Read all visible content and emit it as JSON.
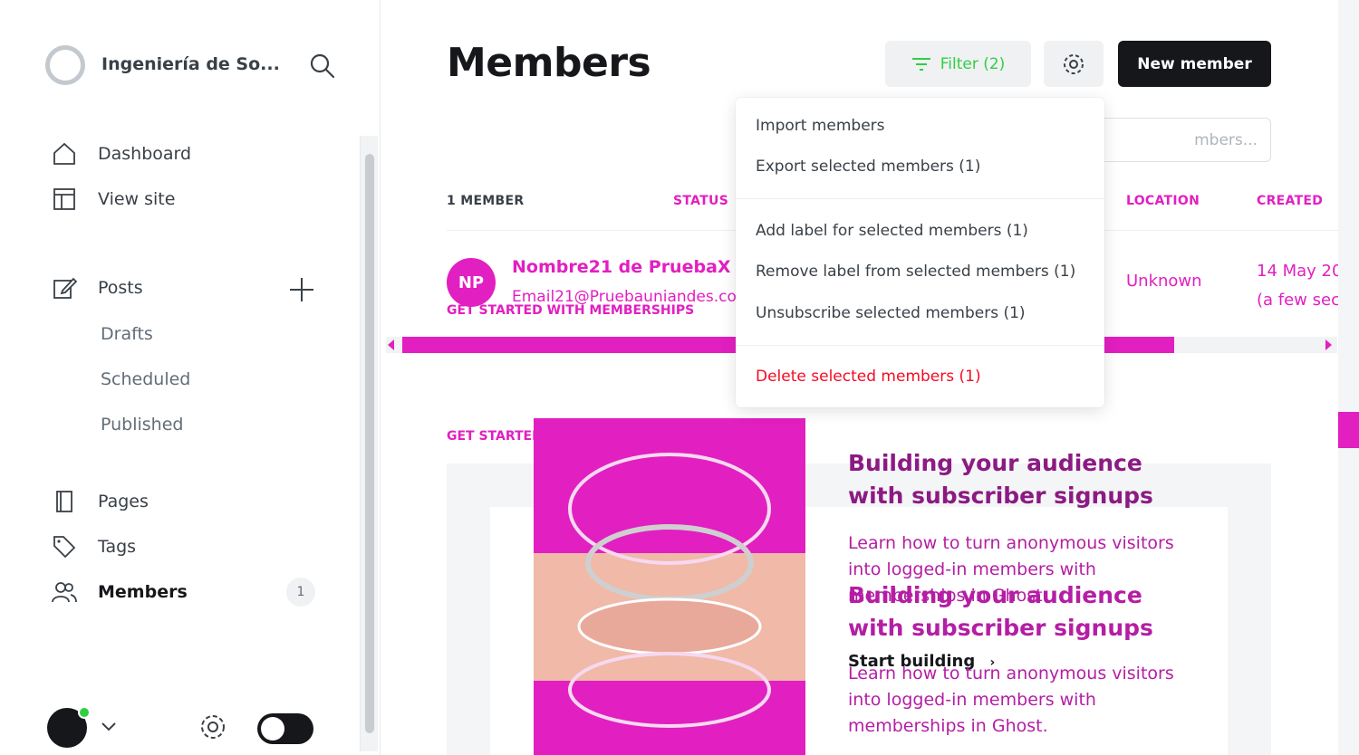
{
  "sidebar": {
    "site_name": "Ingeniería de So...",
    "nav": {
      "dashboard": "Dashboard",
      "view_site": "View site",
      "posts": "Posts",
      "drafts": "Drafts",
      "scheduled": "Scheduled",
      "published": "Published",
      "pages": "Pages",
      "tags": "Tags",
      "members": "Members"
    },
    "members_count": "1"
  },
  "header": {
    "title": "Members",
    "filter_label": "Filter (2)",
    "new_member_label": "New member",
    "search_placeholder": "mbers..."
  },
  "table": {
    "headers": {
      "members_count": "1 MEMBER",
      "status": "STATUS",
      "location": "LOCATION",
      "created": "CREATED"
    },
    "row": {
      "initials": "NP",
      "name": "Nombre21 de PruebaX",
      "email": "Email21@Pruebauniandes.com",
      "location": "Unknown",
      "created_date": "14 May 20",
      "created_relative": "(a few sec"
    }
  },
  "get_started": {
    "label": "GET STARTED WITH MEMBERSHIPS",
    "card_title": "Building your audience with subscriber signups",
    "card_text": "Learn how to turn anonymous visitors into logged-in members with memberships in Ghost.",
    "card_cta": "Start building"
  },
  "dropdown": {
    "import": "Import members",
    "export": "Export selected members (1)",
    "add_label": "Add label for selected members (1)",
    "remove_label": "Remove label from selected members (1)",
    "unsubscribe": "Unsubscribe selected members (1)",
    "delete": "Delete selected members (1)"
  },
  "colors": {
    "accent_green": "#30cf43",
    "highlight_pink": "#e21fc1",
    "danger_red": "#f50b23",
    "dark": "#15171a"
  }
}
